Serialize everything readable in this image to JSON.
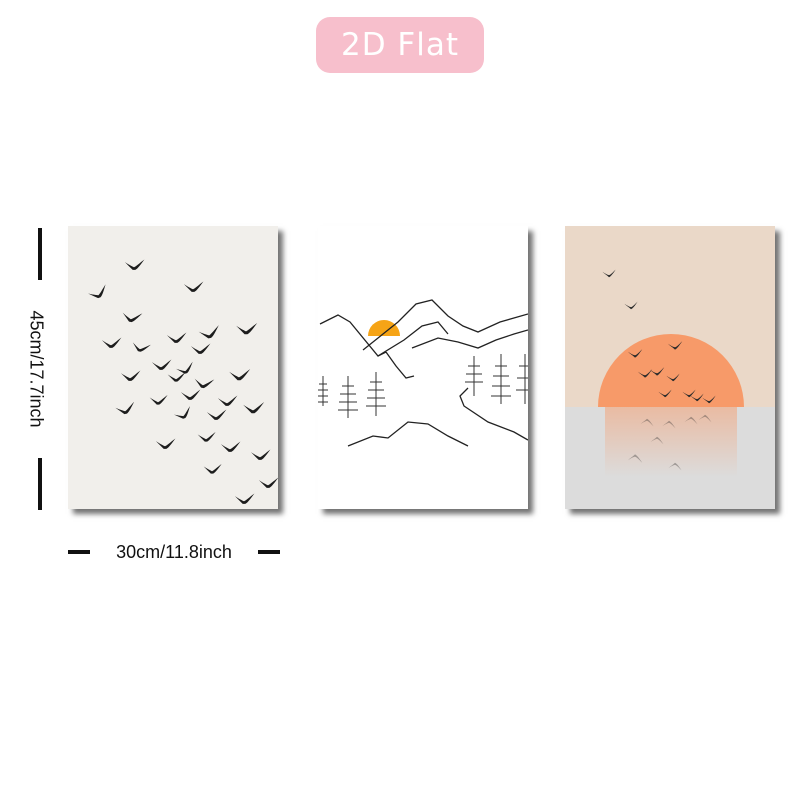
{
  "badge": {
    "label": "2D Flat",
    "background": "#f7bfcc",
    "text_color": "#ffffff"
  },
  "dimensions": {
    "height_label": "45cm/17.7inch",
    "width_label": "30cm/11.8inch"
  },
  "panels": [
    {
      "name": "birds-flock-print",
      "background": "#f1efeb"
    },
    {
      "name": "mountain-line-art-print",
      "background": "#ffffff",
      "sun_color": "#f6a416"
    },
    {
      "name": "sunset-birds-print",
      "sky": "#ead8c8",
      "sun": "#f79a69",
      "water": "#dcdcdc"
    }
  ]
}
